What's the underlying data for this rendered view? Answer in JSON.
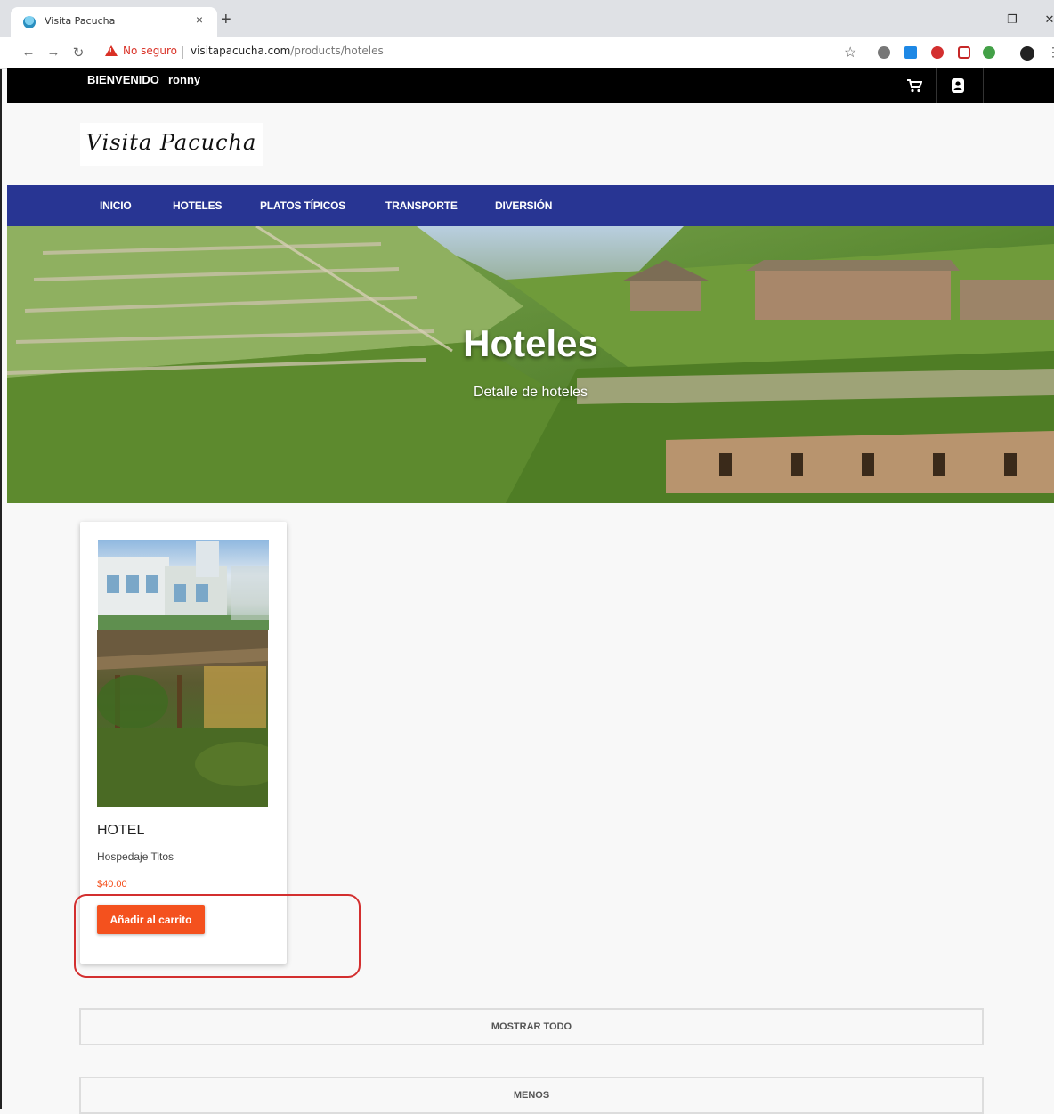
{
  "browser": {
    "tab_title": "Visita Pacucha",
    "tab_close": "×",
    "new_tab": "+",
    "security_label": "No seguro",
    "url_domain": "visitapacucha.com",
    "url_path": "/products/hoteles",
    "window_controls": {
      "minimize": "–",
      "restore": "❐",
      "close": "✕"
    }
  },
  "topbar": {
    "welcome": "BIENVENIDO",
    "user": "ronny"
  },
  "logo": {
    "text": "Visita Pacucha"
  },
  "nav": {
    "items": [
      "INICIO",
      "HOTELES",
      "PLATOS TÍPICOS",
      "TRANSPORTE",
      "DIVERSIÓN"
    ]
  },
  "hero": {
    "title": "Hoteles",
    "subtitle": "Detalle de hoteles"
  },
  "product": {
    "category": "HOTEL",
    "name": "Hospedaje Titos",
    "price": "$40.00",
    "button": "Añadir al carrito"
  },
  "buttons": {
    "show_all": "MOSTRAR TODO",
    "less": "MENOS"
  },
  "colors": {
    "nav": "#283593",
    "accent": "#f4511e",
    "highlight": "#d32f2f",
    "topbar": "#000000"
  }
}
